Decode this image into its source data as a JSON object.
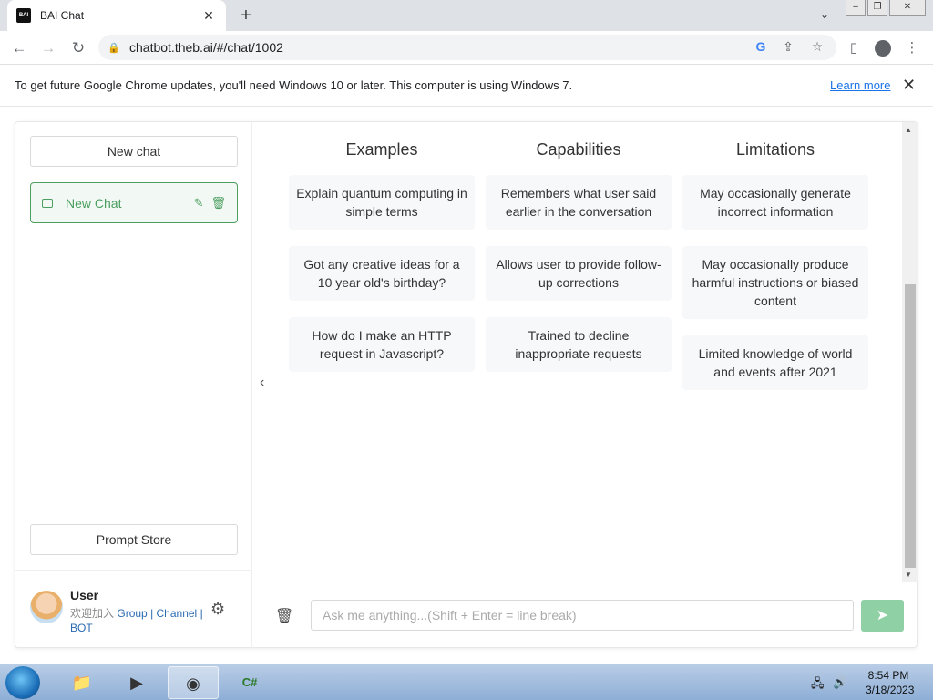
{
  "browser": {
    "tab_title": "BAI Chat",
    "tab_favicon_text": "BAI",
    "url": "chatbot.theb.ai/#/chat/1002",
    "infobar_message": "To get future Google Chrome updates, you'll need Windows 10 or later. This computer is using Windows 7.",
    "infobar_link": "Learn more"
  },
  "sidebar": {
    "new_chat_label": "New chat",
    "chats": [
      {
        "label": "New Chat"
      }
    ],
    "prompt_store_label": "Prompt Store",
    "user": {
      "name": "User",
      "join_text": "欢迎加入",
      "link_group": "Group",
      "link_channel": "Channel",
      "link_bot": "BOT"
    }
  },
  "main": {
    "columns": [
      {
        "title": "Examples",
        "items": [
          "Explain quantum computing in simple terms",
          "Got any creative ideas for a 10 year old's birthday?",
          "How do I make an HTTP request in Javascript?"
        ]
      },
      {
        "title": "Capabilities",
        "items": [
          "Remembers what user said earlier in the conversation",
          "Allows user to provide follow-up corrections",
          "Trained to decline inappropriate requests"
        ]
      },
      {
        "title": "Limitations",
        "items": [
          "May occasionally generate incorrect information",
          "May occasionally produce harmful instructions or biased content",
          "Limited knowledge of world and events after 2021"
        ]
      }
    ],
    "input_placeholder": "Ask me anything...(Shift + Enter = line break)"
  },
  "taskbar": {
    "time": "8:54 PM",
    "date": "3/18/2023"
  },
  "colors": {
    "accent": "#4b9e5f",
    "send_button": "#8fd1a4",
    "link": "#1a73e8"
  }
}
